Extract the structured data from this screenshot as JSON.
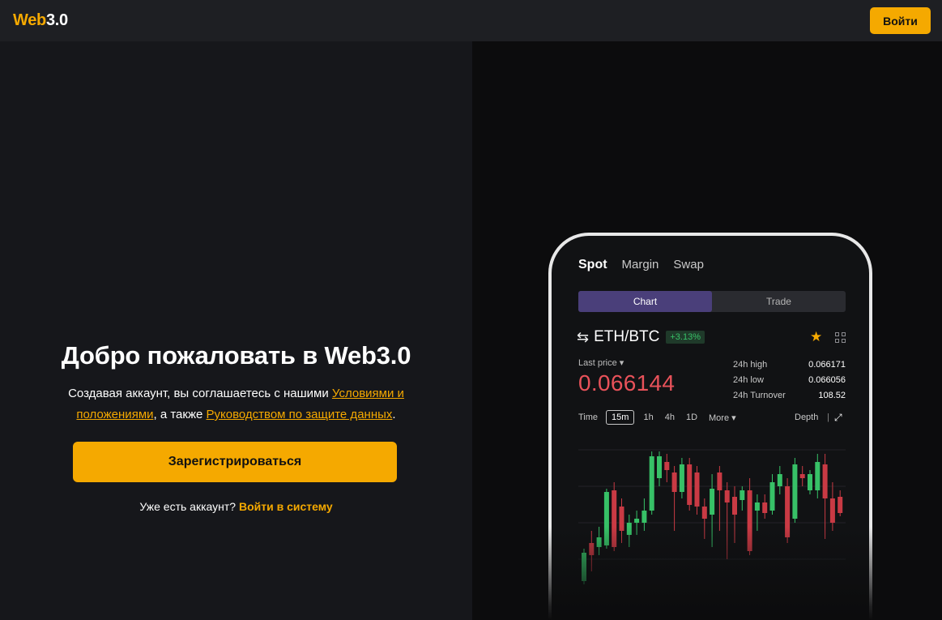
{
  "header": {
    "logo_part1": "Web",
    "logo_part2": "3.0",
    "login_label": "Войти"
  },
  "main": {
    "title": "Добро пожаловать в Web3.0",
    "agree_text": "Создавая аккаунт, вы соглашаетесь с нашими",
    "terms_link": "Условиями и положениями",
    "also_text": ", а также",
    "privacy_link": "Руководством по защите данных",
    "period": ".",
    "signup_label": "Зарегистрироваться",
    "have_account": "Уже есть аккаунт?",
    "signin_link": "Войти в систему"
  },
  "phone": {
    "tabs": [
      "Spot",
      "Margin",
      "Swap"
    ],
    "segments": [
      "Chart",
      "Trade"
    ],
    "pair": "ETH/BTC",
    "change": "+3.13%",
    "last_price_label": "Last price",
    "last_price": "0.066144",
    "stats": [
      {
        "label": "24h high",
        "value": "0.066171"
      },
      {
        "label": "24h low",
        "value": "0.066056"
      },
      {
        "label": "24h Turnover",
        "value": "108.52"
      }
    ],
    "timeframes": {
      "time": "Time",
      "selected": "15m",
      "h1": "1h",
      "h4": "4h",
      "d1": "1D",
      "more": "More",
      "depth": "Depth"
    },
    "colors": {
      "up": "#37c167",
      "down": "#c93a44",
      "accent": "#f5a900"
    }
  }
}
